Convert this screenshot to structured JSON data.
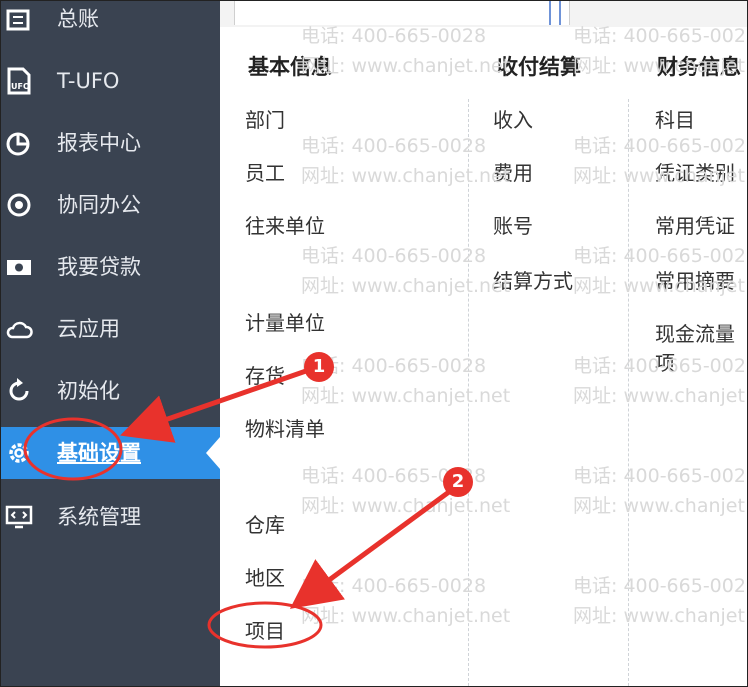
{
  "sidebar": {
    "items": [
      {
        "label": "总账",
        "icon": "ledger-icon"
      },
      {
        "label": "T-UFO",
        "icon": "report-file-icon"
      },
      {
        "label": "报表中心",
        "icon": "pie-chart-icon"
      },
      {
        "label": "协同办公",
        "icon": "collaboration-icon"
      },
      {
        "label": "我要贷款",
        "icon": "money-icon"
      },
      {
        "label": "云应用",
        "icon": "cloud-icon"
      },
      {
        "label": "初始化",
        "icon": "refresh-icon"
      },
      {
        "label": "基础设置",
        "icon": "gear-icon",
        "active": true
      },
      {
        "label": "系统管理",
        "icon": "monitor-code-icon"
      }
    ],
    "background_color": "#3a4351",
    "active_color": "#2f90e6"
  },
  "menu": {
    "columns": [
      {
        "header": "基本信息",
        "items": [
          "部门",
          "员工",
          "往来单位",
          "计量单位",
          "存货",
          "物料清单",
          "仓库",
          "地区",
          "项目"
        ]
      },
      {
        "header": "收付结算",
        "items": [
          "收入",
          "费用",
          "账号",
          "结算方式"
        ]
      },
      {
        "header": "财务信息",
        "items": [
          "科目",
          "凭证类别",
          "常用凭证",
          "常用摘要",
          "现金流量项"
        ]
      }
    ]
  },
  "watermark": {
    "phone": "电话: 400-665-0028",
    "site": "网址: www.chanjet.net",
    "color": "#d9d9d9"
  },
  "annotations": {
    "step1": "1",
    "step2": "2",
    "color": "#e8322c"
  }
}
